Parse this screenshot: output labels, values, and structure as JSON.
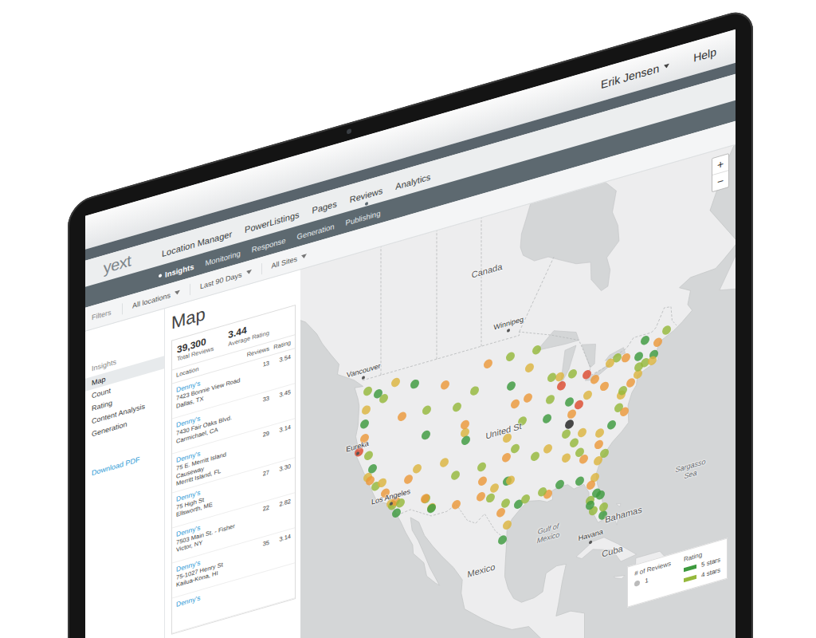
{
  "header": {
    "user": "Erik Jensen",
    "help": "Help"
  },
  "logo": "yext",
  "nav": [
    {
      "label": "Location Manager",
      "selected": false
    },
    {
      "label": "PowerListings",
      "selected": false
    },
    {
      "label": "Pages",
      "selected": false
    },
    {
      "label": "Reviews",
      "selected": true
    },
    {
      "label": "Analytics",
      "selected": false
    }
  ],
  "subnav": [
    {
      "label": "Insights",
      "selected": true
    },
    {
      "label": "Monitoring",
      "selected": false
    },
    {
      "label": "Response",
      "selected": false
    },
    {
      "label": "Generation",
      "selected": false
    },
    {
      "label": "Publishing",
      "selected": false
    }
  ],
  "filters": {
    "label": "Filters",
    "dropdowns": [
      "All locations",
      "Last 90 Days",
      "All Sites"
    ]
  },
  "sidebar": {
    "heading": "Insights",
    "items": [
      {
        "label": "Map",
        "selected": true
      },
      {
        "label": "Count",
        "selected": false
      },
      {
        "label": "Rating",
        "selected": false
      },
      {
        "label": "Content Analysis",
        "selected": false
      },
      {
        "label": "Generation",
        "selected": false
      }
    ],
    "link": "Download PDF"
  },
  "page_title": "Map",
  "summary": [
    {
      "value": "39,300",
      "label": "Total Reviews"
    },
    {
      "value": "3.44",
      "label": "Average Rating"
    }
  ],
  "table": {
    "columns": [
      "Location",
      "Reviews",
      "Rating"
    ],
    "rows": [
      {
        "name": "Denny's",
        "address": "7423 Bonnie View Road",
        "city": "Dallas, TX",
        "reviews": "13",
        "rating": "3.54"
      },
      {
        "name": "Denny's",
        "address": "7430 Fair Oaks Blvd.",
        "city": "Carmichael, CA",
        "reviews": "33",
        "rating": "3.45"
      },
      {
        "name": "Denny's",
        "address": "75 E. Merritt Island Causeway",
        "city": "Merritt Island, FL",
        "reviews": "29",
        "rating": "3.14"
      },
      {
        "name": "Denny's",
        "address": "75 High St",
        "city": "Ellsworth, ME",
        "reviews": "27",
        "rating": "3.30"
      },
      {
        "name": "Denny's",
        "address": "7503 Main St. - Fisher",
        "city": "Victor, NY",
        "reviews": "22",
        "rating": "2.82"
      },
      {
        "name": "Denny's",
        "address": "75-1027 Henry St",
        "city": "Kailua-Kona, HI",
        "reviews": "35",
        "rating": "3.14"
      },
      {
        "name": "Denny's"
      }
    ]
  },
  "map": {
    "zoom": [
      "+",
      "−"
    ],
    "labels": [
      {
        "text": "Canada",
        "kind": "country",
        "lon": -101,
        "lat": 57.5
      },
      {
        "text": "Winnipeg",
        "kind": "city",
        "lon": -97.1,
        "lat": 49.9
      },
      {
        "text": "Vancouver",
        "kind": "city",
        "lon": -123.1,
        "lat": 49.3
      },
      {
        "text": "Eureka",
        "kind": "city",
        "lon": -124.2,
        "lat": 40.8
      },
      {
        "text": "United St",
        "kind": "country",
        "lon": -98,
        "lat": 38.6
      },
      {
        "text": "Los Angeles",
        "kind": "city",
        "lon": -118.2,
        "lat": 34
      },
      {
        "text": "Gulf of Mexico",
        "kind": "water",
        "lon": -90,
        "lat": 25.5
      },
      {
        "text": "Mexico",
        "kind": "country",
        "lon": -102,
        "lat": 23.5
      },
      {
        "text": "Havana",
        "kind": "city",
        "lon": -82.4,
        "lat": 23.1
      },
      {
        "text": "Cuba",
        "kind": "country",
        "lon": -78.5,
        "lat": 21.4
      },
      {
        "text": "Bahamas",
        "kind": "country",
        "lon": -76.5,
        "lat": 25.2
      },
      {
        "text": "Sargasso Sea",
        "kind": "water",
        "lon": -64.5,
        "lat": 28
      }
    ],
    "dots": [
      {
        "lon": -122.3,
        "lat": 47.6,
        "color": "#95b83c"
      },
      {
        "lon": -122.7,
        "lat": 45.5,
        "color": "#dcb53f"
      },
      {
        "lon": -123,
        "lat": 44,
        "color": "#3d9a3e"
      },
      {
        "lon": -122.9,
        "lat": 42.3,
        "color": "#eb983a"
      },
      {
        "lon": -124,
        "lat": 41,
        "color": "#dc4a2f"
      },
      {
        "lon": -122.4,
        "lat": 37.8,
        "color": "#dcb53f"
      },
      {
        "lon": -121.9,
        "lat": 37.3,
        "color": "#eb983a"
      },
      {
        "lon": -121.5,
        "lat": 38.6,
        "color": "#3d9a3e"
      },
      {
        "lon": -120.9,
        "lat": 36.5,
        "color": "#95b83c"
      },
      {
        "lon": -119.8,
        "lat": 36.7,
        "color": "#dcb53f"
      },
      {
        "lon": -119.2,
        "lat": 35.4,
        "color": "#eb983a"
      },
      {
        "lon": -118.2,
        "lat": 34.05,
        "color": "#dcb53f"
      },
      {
        "lon": -117.9,
        "lat": 33.8,
        "color": "#95b83c"
      },
      {
        "lon": -117.2,
        "lat": 32.8,
        "color": "#3d9a3e"
      },
      {
        "lon": -117.4,
        "lat": 34.1,
        "color": "#eb983a"
      },
      {
        "lon": -116.5,
        "lat": 33.8,
        "color": "#95b83c"
      },
      {
        "lon": -115.1,
        "lat": 36.2,
        "color": "#eb983a"
      },
      {
        "lon": -111.9,
        "lat": 33.4,
        "color": "#95b83c"
      },
      {
        "lon": -111,
        "lat": 32.2,
        "color": "#dcb53f"
      },
      {
        "lon": -112,
        "lat": 40.7,
        "color": "#3d9a3e"
      },
      {
        "lon": -111.8,
        "lat": 43.5,
        "color": "#95b83c"
      },
      {
        "lon": -116.2,
        "lat": 43.6,
        "color": "#eb983a"
      },
      {
        "lon": -117.4,
        "lat": 47.7,
        "color": "#dcb53f"
      },
      {
        "lon": -119.5,
        "lat": 46.2,
        "color": "#95b83c"
      },
      {
        "lon": -114,
        "lat": 46.9,
        "color": "#3d9a3e"
      },
      {
        "lon": -108.5,
        "lat": 45.8,
        "color": "#eb983a"
      },
      {
        "lon": -106.3,
        "lat": 42.9,
        "color": "#95b83c"
      },
      {
        "lon": -104.9,
        "lat": 39.7,
        "color": "#dcb53f"
      },
      {
        "lon": -104.8,
        "lat": 38.8,
        "color": "#3d9a3e"
      },
      {
        "lon": -105,
        "lat": 40.6,
        "color": "#eb983a"
      },
      {
        "lon": -106.6,
        "lat": 35.1,
        "color": "#95b83c"
      },
      {
        "lon": -106.5,
        "lat": 31.8,
        "color": "#eb983a"
      },
      {
        "lon": -108.6,
        "lat": 37,
        "color": "#dcb53f"
      },
      {
        "lon": -101.9,
        "lat": 35.2,
        "color": "#95b83c"
      },
      {
        "lon": -101.8,
        "lat": 33.6,
        "color": "#eb983a"
      },
      {
        "lon": -97.3,
        "lat": 32.8,
        "color": "#3d9a3e"
      },
      {
        "lon": -96.8,
        "lat": 32.8,
        "color": "#dcb53f"
      },
      {
        "lon": -97.7,
        "lat": 30.3,
        "color": "#95b83c"
      },
      {
        "lon": -98.5,
        "lat": 29.4,
        "color": "#eb983a"
      },
      {
        "lon": -95.4,
        "lat": 29.8,
        "color": "#3d9a3e"
      },
      {
        "lon": -94.1,
        "lat": 30.1,
        "color": "#95b83c"
      },
      {
        "lon": -97.4,
        "lat": 27.8,
        "color": "#dcb53f"
      },
      {
        "lon": -98.2,
        "lat": 26.2,
        "color": "#3d9a3e"
      },
      {
        "lon": -97.5,
        "lat": 35.5,
        "color": "#eb983a"
      },
      {
        "lon": -95.9,
        "lat": 36.2,
        "color": "#95b83c"
      },
      {
        "lon": -97.3,
        "lat": 37.7,
        "color": "#dcb53f"
      },
      {
        "lon": -94.6,
        "lat": 39.1,
        "color": "#95b83c"
      },
      {
        "lon": -96,
        "lat": 41.3,
        "color": "#eb983a"
      },
      {
        "lon": -100.8,
        "lat": 46.8,
        "color": "#eb983a"
      },
      {
        "lon": -96.8,
        "lat": 46.9,
        "color": "#95b83c"
      },
      {
        "lon": -96.7,
        "lat": 43.5,
        "color": "#3d9a3e"
      },
      {
        "lon": -93.3,
        "lat": 45,
        "color": "#dcb53f"
      },
      {
        "lon": -92.1,
        "lat": 46.8,
        "color": "#95b83c"
      },
      {
        "lon": -93.6,
        "lat": 41.6,
        "color": "#eb983a"
      },
      {
        "lon": -90.2,
        "lat": 38.6,
        "color": "#3d9a3e"
      },
      {
        "lon": -92.3,
        "lat": 34.7,
        "color": "#95b83c"
      },
      {
        "lon": -90.1,
        "lat": 35.1,
        "color": "#dcb53f"
      },
      {
        "lon": -90.1,
        "lat": 30,
        "color": "#eb983a"
      },
      {
        "lon": -91.1,
        "lat": 30.4,
        "color": "#95b83c"
      },
      {
        "lon": -88,
        "lat": 30.7,
        "color": "#3d9a3e"
      },
      {
        "lon": -86.8,
        "lat": 33.5,
        "color": "#dcb53f"
      },
      {
        "lon": -86.8,
        "lat": 36.2,
        "color": "#95b83c"
      },
      {
        "lon": -85.8,
        "lat": 38.3,
        "color": "#eb983a"
      },
      {
        "lon": -84.5,
        "lat": 39.1,
        "color": "#dc4a2f"
      },
      {
        "lon": -83,
        "lat": 40,
        "color": "#dcb53f"
      },
      {
        "lon": -81.7,
        "lat": 41.5,
        "color": "#eb983a"
      },
      {
        "lon": -83.1,
        "lat": 42.3,
        "color": "#dc4a2f"
      },
      {
        "lon": -85.7,
        "lat": 42.9,
        "color": "#95b83c"
      },
      {
        "lon": -87.6,
        "lat": 41.9,
        "color": "#dc4a2f"
      },
      {
        "lon": -88,
        "lat": 43,
        "color": "#dcb53f"
      },
      {
        "lon": -89.4,
        "lat": 43.1,
        "color": "#95b83c"
      },
      {
        "lon": -86.2,
        "lat": 39.8,
        "color": "#3d9a3e"
      },
      {
        "lon": -84.4,
        "lat": 33.7,
        "color": "#95b83c"
      },
      {
        "lon": -81,
        "lat": 34,
        "color": "#eb983a"
      },
      {
        "lon": -80.8,
        "lat": 35.2,
        "color": "#dcb53f"
      },
      {
        "lon": -78.6,
        "lat": 35.8,
        "color": "#3d9a3e"
      },
      {
        "lon": -77.4,
        "lat": 37.5,
        "color": "#95b83c"
      },
      {
        "lon": -76.3,
        "lat": 36.9,
        "color": "#eb983a"
      },
      {
        "lon": -77,
        "lat": 38.9,
        "color": "#dcb53f"
      },
      {
        "lon": -76.6,
        "lat": 39.3,
        "color": "#95b83c"
      },
      {
        "lon": -75.2,
        "lat": 40,
        "color": "#eb983a"
      },
      {
        "lon": -74,
        "lat": 40.7,
        "color": "#dcb53f"
      },
      {
        "lon": -73.8,
        "lat": 41.5,
        "color": "#95b83c"
      },
      {
        "lon": -73.8,
        "lat": 42.7,
        "color": "#3d9a3e"
      },
      {
        "lon": -76.1,
        "lat": 43,
        "color": "#eb983a"
      },
      {
        "lon": -77.6,
        "lat": 43.2,
        "color": "#95b83c"
      },
      {
        "lon": -78.9,
        "lat": 42.9,
        "color": "#dcb53f"
      },
      {
        "lon": -79.9,
        "lat": 40.4,
        "color": "#eb983a"
      },
      {
        "lon": -72.7,
        "lat": 41.8,
        "color": "#95b83c"
      },
      {
        "lon": -71.1,
        "lat": 42.4,
        "color": "#3d9a3e"
      },
      {
        "lon": -71.4,
        "lat": 41.8,
        "color": "#dcb53f"
      },
      {
        "lon": -70.3,
        "lat": 43.7,
        "color": "#eb983a"
      },
      {
        "lon": -68.8,
        "lat": 44.8,
        "color": "#95b83c"
      },
      {
        "lon": -72.6,
        "lat": 44.3,
        "color": "#3d9a3e"
      },
      {
        "lon": -81.4,
        "lat": 28.5,
        "color": "#3d9a3e"
      },
      {
        "lon": -82.5,
        "lat": 27.9,
        "color": "#95b83c"
      },
      {
        "lon": -80.2,
        "lat": 25.8,
        "color": "#3d9a3e"
      },
      {
        "lon": -80.1,
        "lat": 26.7,
        "color": "#95b83c"
      },
      {
        "lon": -81.7,
        "lat": 30.3,
        "color": "#dcb53f"
      },
      {
        "lon": -84.3,
        "lat": 30.4,
        "color": "#3d9a3e"
      },
      {
        "lon": -82.3,
        "lat": 29.6,
        "color": "#eb983a"
      },
      {
        "lon": -81.9,
        "lat": 26.6,
        "color": "#95b83c"
      },
      {
        "lon": -80.6,
        "lat": 28.1,
        "color": "#3d9a3e"
      },
      {
        "lon": -79.9,
        "lat": 32.8,
        "color": "#95b83c"
      },
      {
        "lon": -81.1,
        "lat": 32.1,
        "color": "#dcb53f"
      },
      {
        "lon": -83.6,
        "lat": 32.8,
        "color": "#eb983a"
      },
      {
        "lon": -85.3,
        "lat": 35,
        "color": "#95b83c"
      },
      {
        "lon": -83.9,
        "lat": 35.9,
        "color": "#dcb53f"
      },
      {
        "lon": -82.5,
        "lat": 27.3,
        "color": "#3d9a3e"
      },
      {
        "lon": -99.7,
        "lat": 32.4,
        "color": "#dcb53f"
      },
      {
        "lon": -100.4,
        "lat": 31.4,
        "color": "#95b83c"
      },
      {
        "lon": -102.1,
        "lat": 31.9,
        "color": "#eb983a"
      },
      {
        "lon": -103.2,
        "lat": 44.1,
        "color": "#95b83c"
      },
      {
        "lon": -110.9,
        "lat": 32.1,
        "color": "#3d9a3e"
      },
      {
        "lon": -112.1,
        "lat": 33.5,
        "color": "#eb983a"
      },
      {
        "lon": -122.2,
        "lat": 40.2,
        "color": "#95b83c"
      },
      {
        "lon": -120.5,
        "lat": 47,
        "color": "#3d9a3e"
      },
      {
        "lon": -113.5,
        "lat": 37.1,
        "color": "#dcb53f"
      },
      {
        "lon": -89.6,
        "lat": 40.7,
        "color": "#95b83c"
      },
      {
        "lon": -86.2,
        "lat": 37.2,
        "color": "#222222"
      }
    ],
    "legend": {
      "reviews_title": "# of Reviews",
      "reviews": [
        {
          "label": "1"
        }
      ],
      "rating_title": "Rating",
      "ratings": [
        {
          "label": "5 stars",
          "color": "#3d9a3e"
        },
        {
          "label": "4 stars",
          "color": "#95b83c"
        }
      ]
    }
  }
}
